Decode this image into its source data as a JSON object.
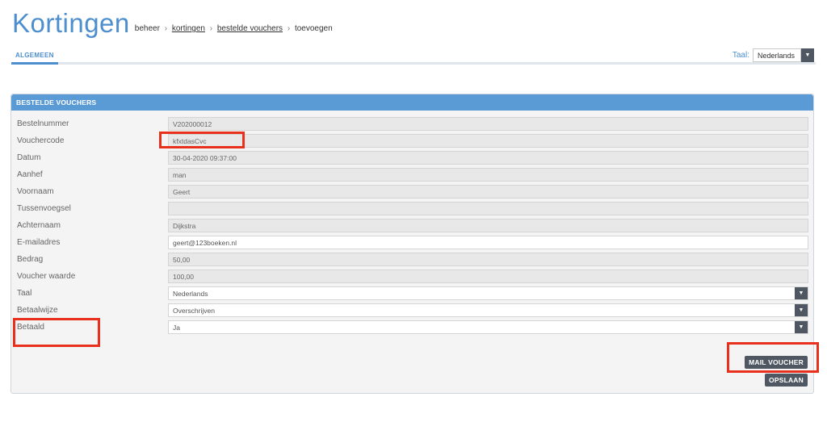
{
  "header": {
    "title": "Kortingen",
    "breadcrumb": {
      "home": "beheer",
      "separator": "›",
      "level1": "kortingen",
      "level2": "bestelde vouchers",
      "current": "toevoegen"
    }
  },
  "tabs": [
    {
      "label": "ALGEMEEN",
      "active": true
    }
  ],
  "language": {
    "label": "Taal:",
    "value": "Nederlands"
  },
  "panel": {
    "title": "BESTELDE VOUCHERS",
    "fields": [
      {
        "label": "Bestelnummer",
        "value": "V202000012",
        "editable": false,
        "select": false
      },
      {
        "label": "Vouchercode",
        "value": "kfxtdasCvc",
        "editable": false,
        "select": false
      },
      {
        "label": "Datum",
        "value": "30-04-2020 09:37:00",
        "editable": false,
        "select": false
      },
      {
        "label": "Aanhef",
        "value": "man",
        "editable": false,
        "select": false
      },
      {
        "label": "Voornaam",
        "value": "Geert",
        "editable": false,
        "select": false
      },
      {
        "label": "Tussenvoegsel",
        "value": "",
        "editable": false,
        "select": false
      },
      {
        "label": "Achternaam",
        "value": "Dijkstra",
        "editable": false,
        "select": false
      },
      {
        "label": "E-mailadres",
        "value": "geert@123boeken.nl",
        "editable": true,
        "select": false
      },
      {
        "label": "Bedrag",
        "value": "50,00",
        "editable": false,
        "select": false
      },
      {
        "label": "Voucher waarde",
        "value": "100,00",
        "editable": false,
        "select": false
      },
      {
        "label": "Taal",
        "value": "Nederlands",
        "editable": true,
        "select": true
      },
      {
        "label": "Betaalwijze",
        "value": "Overschrijven",
        "editable": true,
        "select": true
      },
      {
        "label": "Betaald",
        "value": "Ja",
        "editable": true,
        "select": true
      }
    ],
    "buttons": {
      "mail_voucher": "MAIL VOUCHER",
      "save": "OPSLAAN"
    }
  },
  "colors": {
    "accent": "#4d8fce",
    "panel_header": "#5b9bd5",
    "button": "#4f5862",
    "annotation": "#e8301c"
  }
}
